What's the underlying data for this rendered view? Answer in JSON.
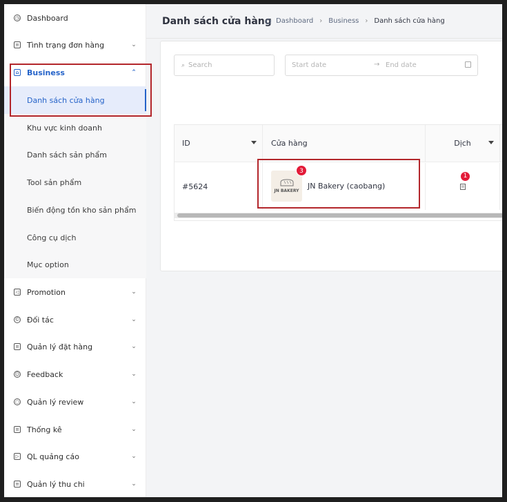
{
  "sidebar": {
    "items": [
      {
        "label": "Dashboard",
        "icon": "dashboard-icon"
      },
      {
        "label": "Tình trạng đơn hàng",
        "icon": "order-status-icon"
      },
      {
        "label": "Business",
        "icon": "bank-icon"
      },
      {
        "label": "Promotion",
        "icon": "megaphone-icon"
      },
      {
        "label": "Đối tác",
        "icon": "partner-icon"
      },
      {
        "label": "Quản lý đặt hàng",
        "icon": "order-manage-icon"
      },
      {
        "label": "Feedback",
        "icon": "smile-icon"
      },
      {
        "label": "Quản lý review",
        "icon": "review-icon"
      },
      {
        "label": "Thống kê",
        "icon": "stats-icon"
      },
      {
        "label": "QL quảng cáo",
        "icon": "ads-icon"
      },
      {
        "label": "Quản lý thu chi",
        "icon": "finance-icon"
      }
    ],
    "business_sub": [
      "Danh sách cửa hàng",
      "Khu vực kinh doanh",
      "Danh sách sản phẩm",
      "Tool sản phẩm",
      "Biến động tồn kho sản phẩm",
      "Công cụ dịch",
      "Mục option"
    ]
  },
  "header": {
    "title": "Danh sách cửa hàng",
    "breadcrumb": [
      "Dashboard",
      "Business",
      "Danh sách cửa hàng"
    ]
  },
  "filters": {
    "search_placeholder": "Search",
    "start_placeholder": "Start date",
    "end_placeholder": "End date"
  },
  "table": {
    "columns": [
      "ID",
      "Cửa hàng",
      "Dịch"
    ],
    "rows": [
      {
        "id": "#5624",
        "store": "JN Bakery (caobang)",
        "logo_text": "JN BAKERY",
        "store_badge": "3",
        "translate_badge": "1"
      }
    ]
  },
  "colors": {
    "accent": "#2563c9",
    "highlight": "#b3262b",
    "badge": "#e31b38"
  }
}
